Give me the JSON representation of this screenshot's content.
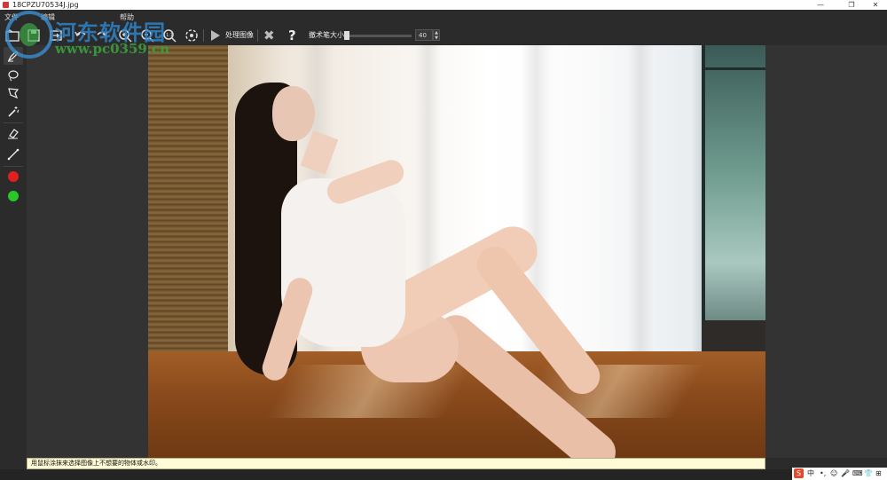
{
  "window": {
    "title": "18CPZU70534J.jpg",
    "minimize_glyph": "—",
    "restore_glyph": "❐",
    "close_glyph": "✕"
  },
  "menu": {
    "items": [
      "文件",
      "编辑",
      "帮助"
    ]
  },
  "toolbar": {
    "process_label": "处理图像",
    "brush_size_label": "撤术笔大小",
    "brush_size_value": "40",
    "help_glyph": "?",
    "cancel_glyph": "✖",
    "spin_up": "▲",
    "spin_down": "▼"
  },
  "tools": [
    {
      "name": "brush-tool-icon"
    },
    {
      "name": "lasso-tool-icon"
    },
    {
      "name": "polygon-lasso-tool-icon"
    },
    {
      "name": "magic-wand-tool-icon"
    },
    {
      "name": "eraser-tool-icon"
    },
    {
      "name": "line-tool-icon"
    }
  ],
  "colors": {
    "marker_red": "#e02020",
    "marker_green": "#28c828",
    "background": "#2b2b2b",
    "status_bg": "#fffbd6"
  },
  "status": {
    "hint": "用鼠标涂抹来选择图像上不想要的物体或水印。"
  },
  "watermark": {
    "site_name": "河东软件园",
    "url": "www.pc0359.cn"
  },
  "tray": {
    "ime_logo": "S",
    "lang": "中",
    "items": [
      "•,",
      "☺",
      "🎤",
      "⌨",
      "👕",
      "⊞"
    ]
  }
}
